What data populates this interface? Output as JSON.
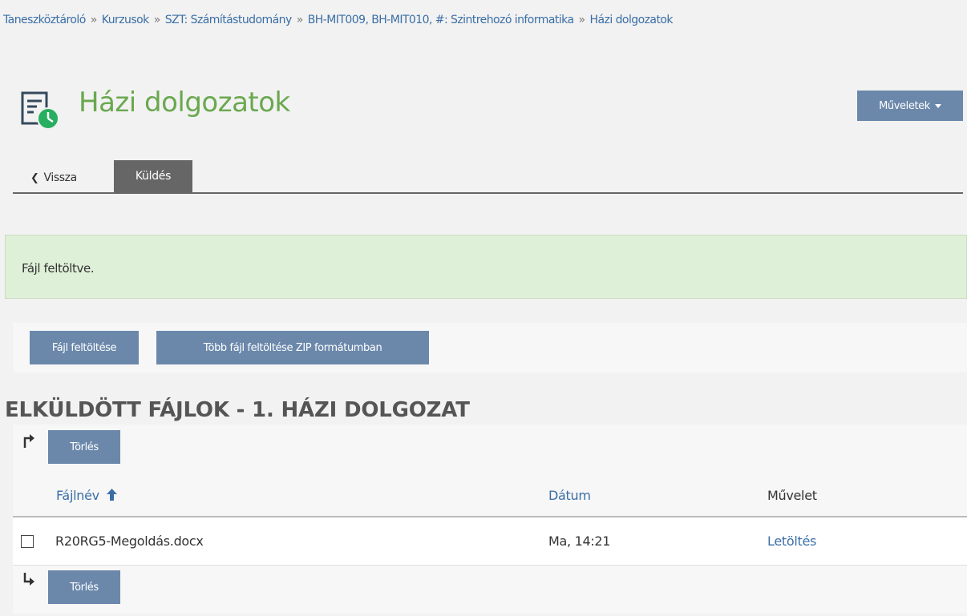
{
  "breadcrumb": {
    "items": [
      "Taneszköztároló",
      "Kurzusok",
      "SZT: Számítástudomány",
      "BH-MIT009, BH-MIT010, #: Szintrehozó informatika",
      "Házi dolgozatok"
    ],
    "separator": "»"
  },
  "header": {
    "title": "Házi dolgozatok",
    "icon": "assignment-clock-icon",
    "actions_label": "Műveletek"
  },
  "tabs": {
    "back_label": "Vissza",
    "active_label": "Küldés"
  },
  "alert": {
    "message": "Fájl feltöltve."
  },
  "upload": {
    "single_label": "Fájl feltöltése",
    "zip_label": "Több fájl feltöltése ZIP formátumban"
  },
  "files": {
    "section_title": "ELKÜLDÖTT FÁJLOK - 1. HÁZI DOLGOZAT",
    "delete_label": "Törlés",
    "columns": {
      "name": "Fájlnév",
      "date": "Dátum",
      "action": "Művelet"
    },
    "rows": [
      {
        "name": "R20RG5-Megoldás.docx",
        "date": "Ma, 14:21",
        "action": "Letöltés"
      }
    ]
  },
  "colors": {
    "title_green": "#6aa84f",
    "button_blue": "#6b88ab",
    "link_blue": "#3a6ea5",
    "alert_green": "#dff0d8",
    "tab_active": "#666666"
  }
}
